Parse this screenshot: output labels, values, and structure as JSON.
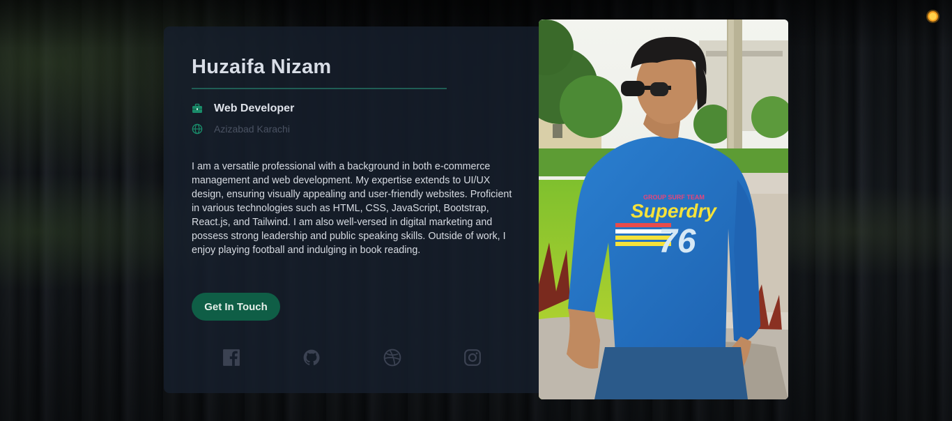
{
  "profile": {
    "name": "Huzaifa Nizam",
    "job_title": "Web Developer",
    "location": "Azizabad Karachi",
    "bio": "I am a versatile professional with a background in both e-commerce management and web development. My expertise extends to UI/UX design, ensuring visually appealing and user-friendly websites. Proficient in various technologies such as HTML, CSS, JavaScript, Bootstrap, React.js, and Tailwind. I am also well-versed in digital marketing and possess strong leadership and public speaking skills. Outside of work, I enjoy playing football and indulging in book reading.",
    "cta_label": "Get In Touch"
  },
  "socials": [
    {
      "icon": "facebook-icon"
    },
    {
      "icon": "github-icon"
    },
    {
      "icon": "dribbble-icon"
    },
    {
      "icon": "instagram-icon"
    }
  ],
  "photo": {
    "shirt_text_top": "GROUP SURF TEAM",
    "shirt_text_brand": "Superdry",
    "shirt_text_number": "76"
  },
  "colors": {
    "accent": "#0f5e46",
    "icon_green": "#1a8c6a",
    "card_bg": "#161e2c",
    "theme_toggle": "#f5a623"
  }
}
